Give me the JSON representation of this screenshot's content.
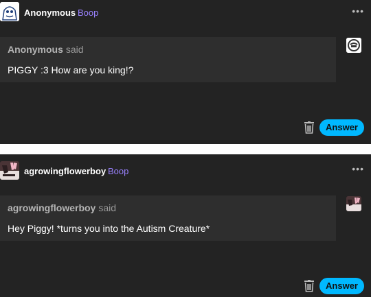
{
  "posts": [
    {
      "sender": "Anonymous",
      "boop_label": "Boop",
      "more_label": "•••",
      "said_name": "Anonymous",
      "said_word": "said",
      "message": "PIGGY :3 How are you king!?",
      "answer_label": "Answer",
      "avatar_icon": "anonymous-avatar-icon"
    },
    {
      "sender": "agrowingflowerboy",
      "boop_label": "Boop",
      "more_label": "•••",
      "said_name": "agrowingflowerboy",
      "said_word": "said",
      "message": "Hey Piggy! *turns you into the Autism Creature*",
      "answer_label": "Answer",
      "avatar_icon": "user-avatar-icon"
    }
  ],
  "colors": {
    "card_background": "#232323",
    "bubble_background": "#2e2e2e",
    "boop_accent": "#9a82ff",
    "answer_button": "#00b8ff"
  }
}
